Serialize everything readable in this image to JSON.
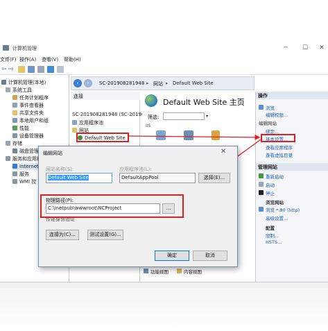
{
  "window": {
    "title": "计算机管理",
    "controls": [
      "─",
      "☐",
      "✕"
    ]
  },
  "menu": [
    "文件(F)",
    "操作(A)",
    "查看(V)",
    "帮助(H)"
  ],
  "tree": {
    "items": [
      {
        "label": "计算机管理(本地)"
      },
      {
        "label": "系统工具"
      },
      {
        "label": "任务计划程序"
      },
      {
        "label": "事件查看器"
      },
      {
        "label": "共享文件夹"
      },
      {
        "label": "本地用户和组"
      },
      {
        "label": "性能"
      },
      {
        "label": "设备管理器"
      },
      {
        "label": "存储"
      },
      {
        "label": "磁盘管理"
      },
      {
        "label": "服务和应用程序"
      },
      {
        "label": "Internet"
      },
      {
        "label": "服务"
      },
      {
        "label": "WMI 控"
      }
    ]
  },
  "breadcrumb": [
    "SC-201908281948",
    "网站",
    "Default Web Site"
  ],
  "connections": {
    "header": "连接",
    "server": "SC-201908281948 (SC-201908",
    "app_pools": "应用程序池",
    "sites": "网站",
    "default_site": "Default Web Site"
  },
  "home": {
    "title": "Default Web Site 主页",
    "filter_label": "筛选:",
    "section": "IIS"
  },
  "actions": {
    "header": "操作",
    "group1": [
      "浏览",
      "编辑权限..."
    ],
    "edit_site_header": "编辑网站",
    "group2": [
      "绑定...",
      "基本设置...",
      "查看应用程序",
      "查看虚拟目录"
    ],
    "manage_header": "管理网站",
    "manage": [
      "重新启动",
      "启动",
      "停止"
    ],
    "browse_header": "浏览网站",
    "browse": [
      "浏览 *:80 (http)",
      "高级设置..."
    ],
    "config_header": "配置",
    "config": [
      "限制...",
      "HSTS..."
    ]
  },
  "bottom_tabs": [
    "功能视图",
    "内容视图"
  ],
  "dialog": {
    "title": "编辑网站",
    "site_name_label": "网站名称(S):",
    "site_name": "Default Web Site",
    "pool_label": "应用程序池(L):",
    "pool": "DefaultAppPool",
    "select_button": "选择(E)...",
    "path_label": "物理路径(P):",
    "path": "C:\\inetpub\\wwwroot\\NCProject",
    "browse_button": "...",
    "passthrough_label": "传递身份验证",
    "connect_as_button": "连接为(C)...",
    "test_settings_button": "测试设置(G)...",
    "ok_button": "确定",
    "cancel_button": "取消"
  },
  "colors": {
    "accent": "#1f5fb3",
    "highlight": "#e02020",
    "selection": "#3399ff"
  }
}
